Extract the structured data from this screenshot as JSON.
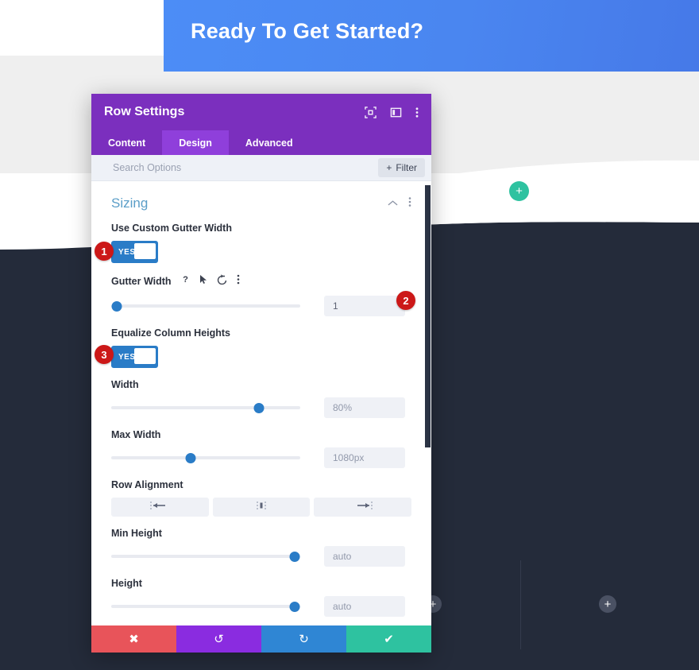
{
  "page": {
    "hero_title": "Ready To Get Started?",
    "colors": {
      "hero_blue": "#4c8df6",
      "dark_bg": "#242b3a",
      "gray_bg": "#efefef",
      "accent_green": "#2ec2a0",
      "modal_purple": "#7b2fbe",
      "badge_red": "#cc1818",
      "toggle_blue": "#2a7cc7",
      "section_title_blue": "#5b9ec8"
    },
    "canvas_buttons": [
      {
        "name": "add-module-green",
        "label": "+"
      },
      {
        "name": "add-module-gray-left",
        "label": "+"
      },
      {
        "name": "add-module-gray-right",
        "label": "+"
      }
    ]
  },
  "modal": {
    "title": "Row Settings",
    "header_icons": [
      "expand-icon",
      "panel-layout-icon",
      "kebab-menu-icon"
    ],
    "tabs": [
      {
        "label": "Content",
        "active": false
      },
      {
        "label": "Design",
        "active": true
      },
      {
        "label": "Advanced",
        "active": false
      }
    ],
    "search": {
      "placeholder": "Search Options",
      "value": ""
    },
    "filter_button": {
      "label": "Filter",
      "plus": "+"
    },
    "section": {
      "title": "Sizing",
      "icons": [
        "chevron-up-icon",
        "kebab-menu-icon"
      ]
    },
    "fields": {
      "use_custom_gutter_width": {
        "label": "Use Custom Gutter Width",
        "toggle_state": "YES",
        "badge": "1"
      },
      "gutter_width": {
        "label": "Gutter Width",
        "icons": [
          "help-icon",
          "pointer-icon",
          "reset-icon",
          "kebab-menu-icon"
        ],
        "value": "1",
        "slider_percent": 3,
        "badge": "2"
      },
      "equalize_column_heights": {
        "label": "Equalize Column Heights",
        "toggle_state": "YES",
        "badge": "3"
      },
      "width": {
        "label": "Width",
        "value": "80%",
        "slider_percent": 78
      },
      "max_width": {
        "label": "Max Width",
        "value": "1080px",
        "slider_percent": 42
      },
      "row_alignment": {
        "label": "Row Alignment",
        "options": [
          "align-left-icon",
          "align-center-icon",
          "align-right-icon"
        ]
      },
      "min_height": {
        "label": "Min Height",
        "value": "auto",
        "slider_percent": 97
      },
      "height": {
        "label": "Height",
        "value": "auto",
        "slider_percent": 97
      }
    },
    "footer_buttons": [
      {
        "name": "discard-button",
        "icon": "close-icon",
        "glyph": "✖"
      },
      {
        "name": "undo-button",
        "icon": "undo-icon",
        "glyph": "↺"
      },
      {
        "name": "redo-button",
        "icon": "redo-icon",
        "glyph": "↻"
      },
      {
        "name": "save-button",
        "icon": "check-icon",
        "glyph": "✔"
      }
    ]
  }
}
